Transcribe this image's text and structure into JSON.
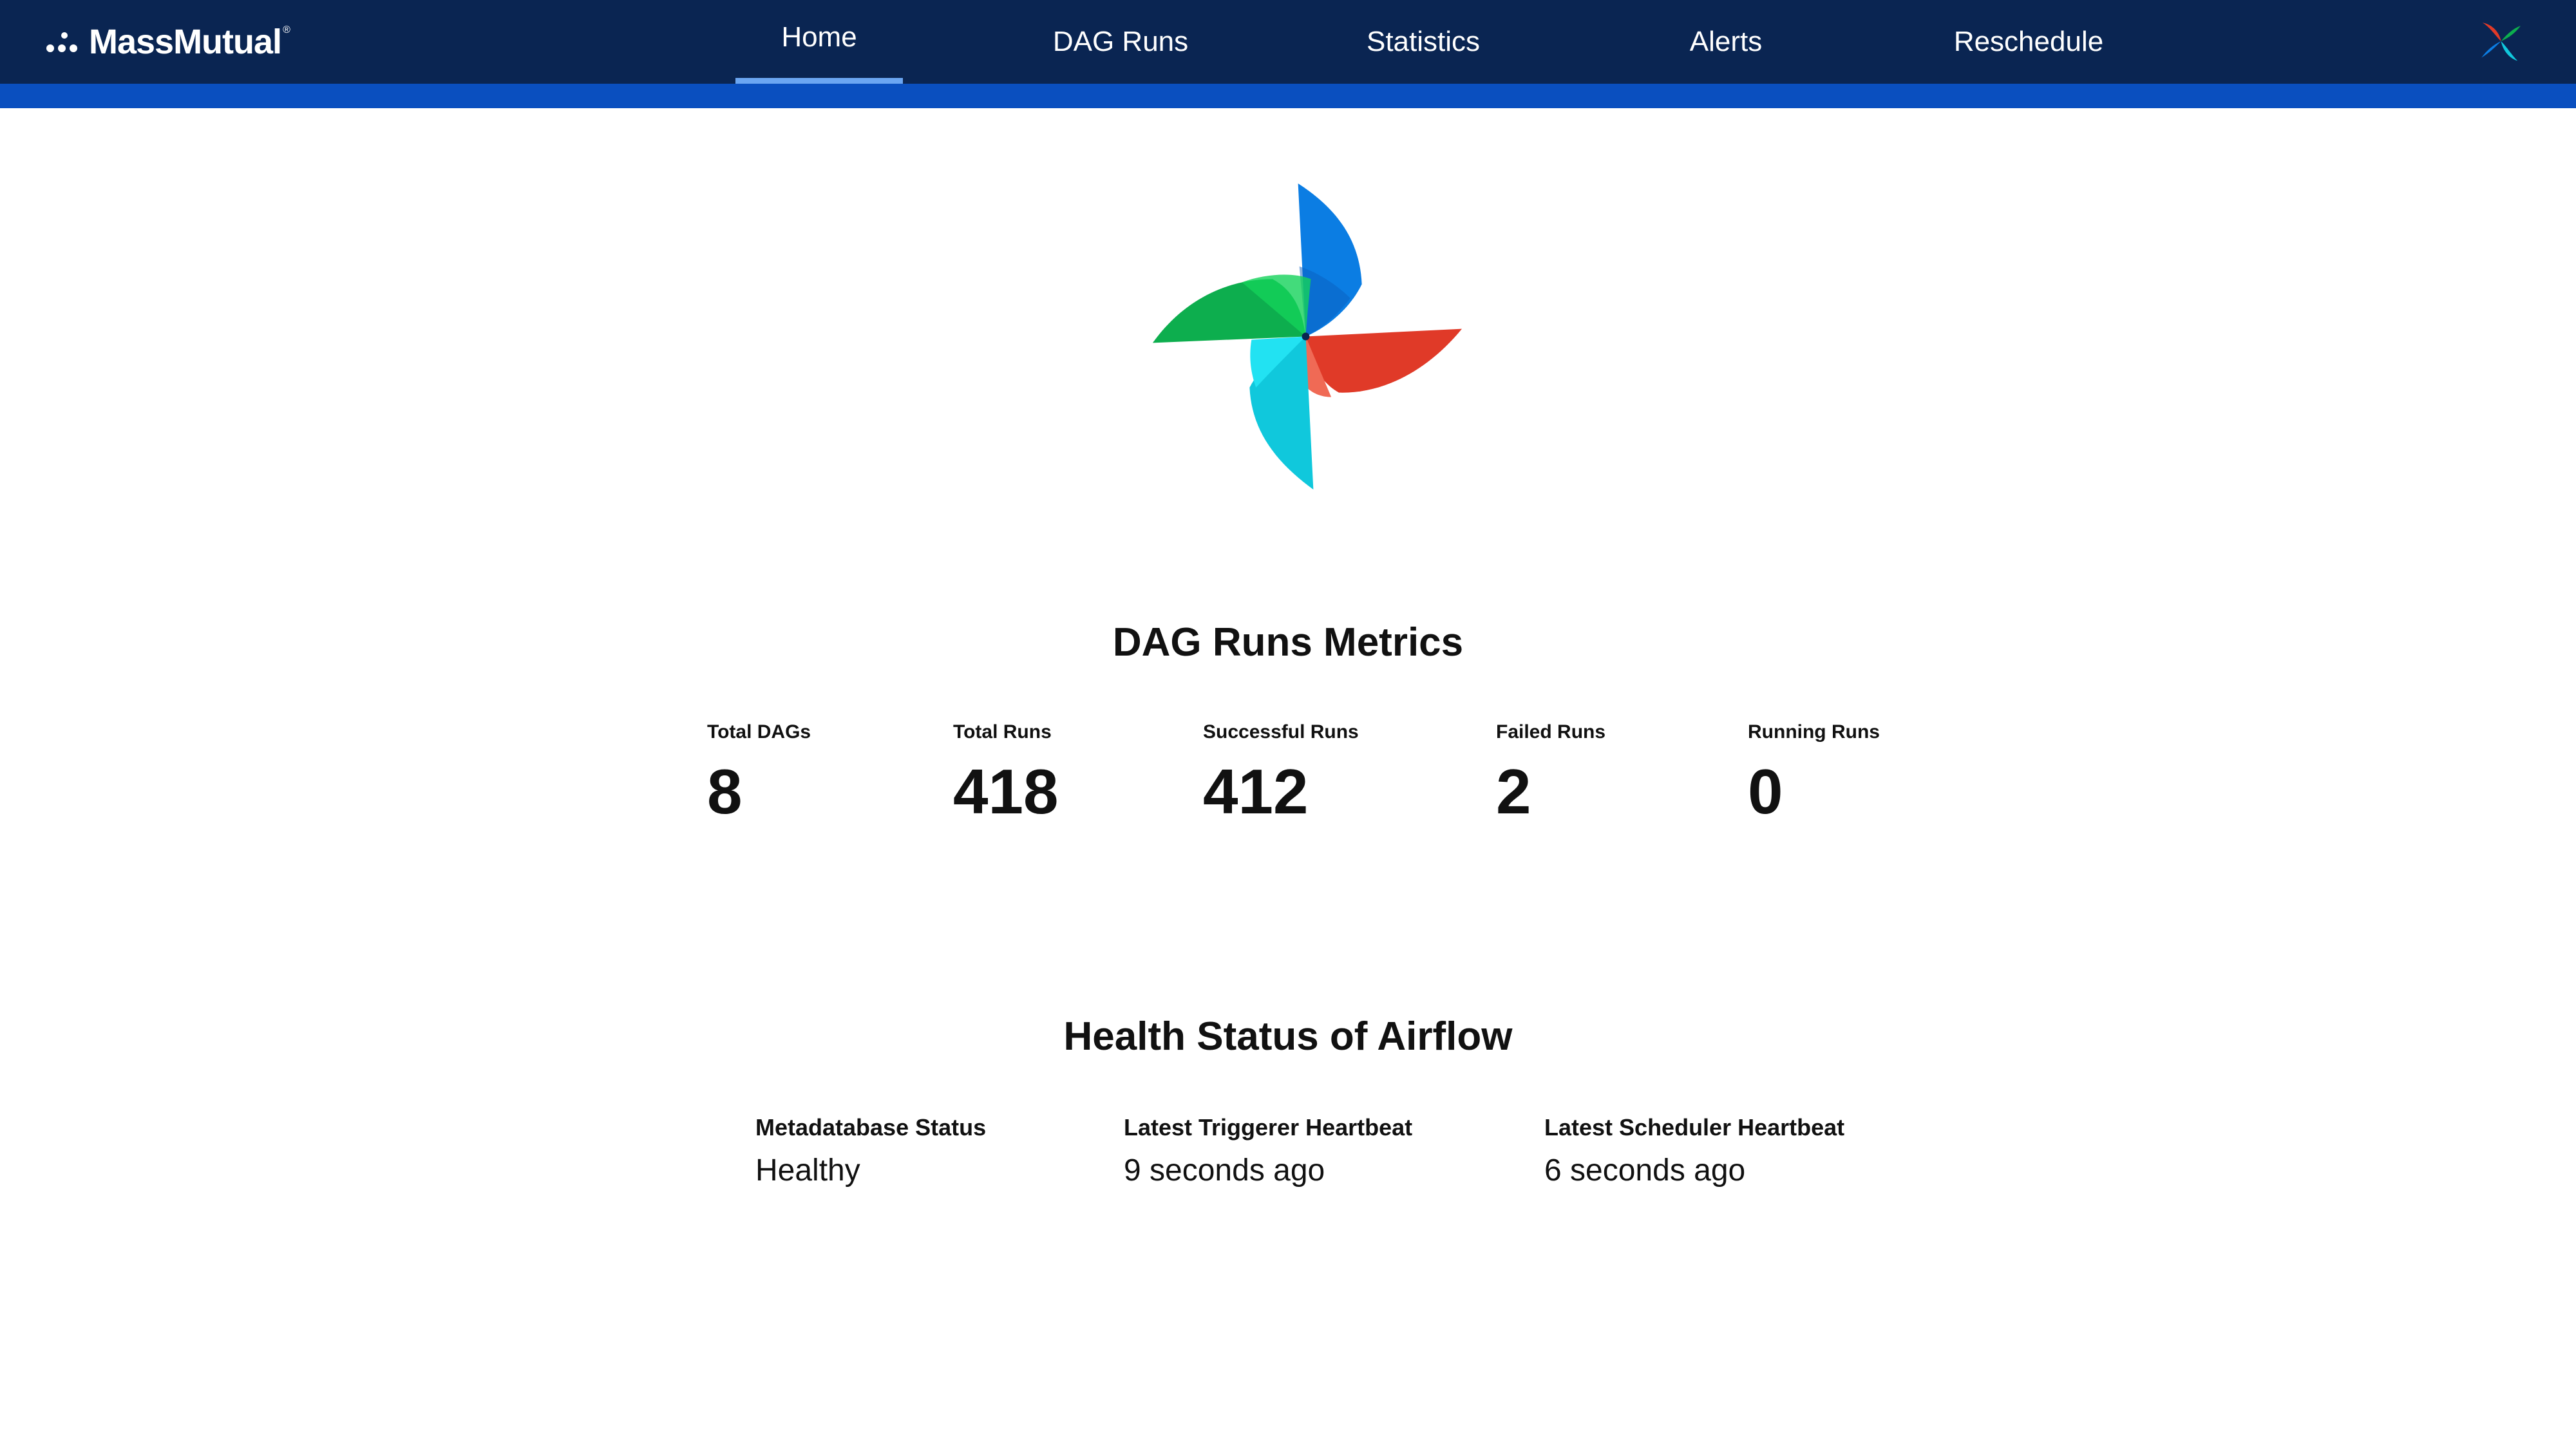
{
  "header": {
    "brand": "MassMutual",
    "brand_mark": "®",
    "nav": [
      {
        "label": "Home",
        "active": true
      },
      {
        "label": "DAG Runs",
        "active": false
      },
      {
        "label": "Statistics",
        "active": false
      },
      {
        "label": "Alerts",
        "active": false
      },
      {
        "label": "Reschedule",
        "active": false
      }
    ],
    "corner_icon": "airflow-pinwheel-icon"
  },
  "hero": {
    "icon": "airflow-pinwheel-icon"
  },
  "metrics": {
    "title": "DAG Runs Metrics",
    "items": [
      {
        "label": "Total DAGs",
        "value": "8"
      },
      {
        "label": "Total Runs",
        "value": "418"
      },
      {
        "label": "Successful Runs",
        "value": "412"
      },
      {
        "label": "Failed Runs",
        "value": "2"
      },
      {
        "label": "Running Runs",
        "value": "0"
      }
    ]
  },
  "health": {
    "title": "Health Status of Airflow",
    "items": [
      {
        "label": "Metadatabase Status",
        "value": "Healthy"
      },
      {
        "label": "Latest Triggerer Heartbeat",
        "value": "9 seconds ago"
      },
      {
        "label": "Latest Scheduler Heartbeat",
        "value": "6 seconds ago"
      }
    ]
  },
  "colors": {
    "nav_bg": "#0a2552",
    "nav_strip": "#0a4fbf",
    "active_underline": "#6ba6f2",
    "pinwheel_blue": "#0b7de3",
    "pinwheel_green": "#0dae4e",
    "pinwheel_red": "#e03a28",
    "pinwheel_cyan": "#10c8dc"
  }
}
